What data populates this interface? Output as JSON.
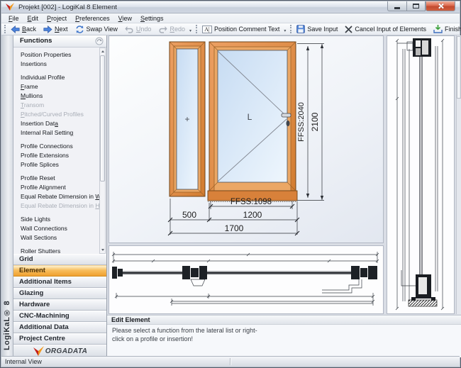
{
  "window": {
    "title": "Projekt [002] - LogiKal 8 Element"
  },
  "menu": {
    "items": [
      {
        "label": "File",
        "accel": 0
      },
      {
        "label": "Edit",
        "accel": 0
      },
      {
        "label": "Project",
        "accel": 0
      },
      {
        "label": "Preferences",
        "accel": 0
      },
      {
        "label": "View",
        "accel": 0
      },
      {
        "label": "Settings",
        "accel": 0
      }
    ]
  },
  "toolbar": {
    "groups": [
      {
        "buttons": [
          {
            "label": "Back",
            "icon": "back-arrow",
            "accel": 0
          },
          {
            "label": "Next",
            "icon": "next-arrow",
            "accel": 0
          },
          {
            "label": "Swap View",
            "icon": "swap-view"
          },
          {
            "label": "Undo",
            "icon": "undo",
            "accel": 0,
            "disabled": true
          },
          {
            "label": "Redo",
            "icon": "redo",
            "accel": 0,
            "disabled": true
          }
        ]
      },
      {
        "buttons": [
          {
            "label": "Position Comment Text",
            "icon": "comment-text"
          }
        ]
      },
      {
        "buttons": [
          {
            "label": "Save Input",
            "icon": "save"
          },
          {
            "label": "Cancel Input of Elements",
            "icon": "cancel"
          },
          {
            "label": "Finish Position",
            "icon": "finish"
          }
        ]
      }
    ]
  },
  "sidebar": {
    "header": "Functions",
    "vertical_label": "LogiKaL® 8",
    "functions": [
      {
        "label": "Position Properties"
      },
      {
        "label": "Insertions"
      },
      {
        "label": "Individual Profile",
        "gap": true
      },
      {
        "label": "Frame",
        "accel": 0
      },
      {
        "label": "Mullions",
        "accel": 0
      },
      {
        "label": "Transom",
        "accel": 0,
        "disabled": true
      },
      {
        "label": "Pitched/Curved Profiles",
        "accel": 0,
        "disabled": true
      },
      {
        "label": "Insertion Data",
        "accel": 13
      },
      {
        "label": "Internal Rail Setting",
        "accel": 20
      },
      {
        "label": "Profile Connections",
        "gap": true
      },
      {
        "label": "Profile Extensions"
      },
      {
        "label": "Profile Splices"
      },
      {
        "label": "Profile Reset",
        "gap": true
      },
      {
        "label": "Profile Alignment"
      },
      {
        "label": "Equal Rebate Dimension in Width",
        "accel": 26
      },
      {
        "label": "Equal Rebate Dimension in Height",
        "accel": 26,
        "disabled": true
      },
      {
        "label": "Side Lights",
        "gap": true
      },
      {
        "label": "Wall Connections"
      },
      {
        "label": "Wall Sections"
      },
      {
        "label": "Roller Shutters",
        "gap": true
      }
    ],
    "accordion": [
      {
        "label": "Grid"
      },
      {
        "label": "Element",
        "active": true
      },
      {
        "label": "Additional Items"
      },
      {
        "label": "Glazing"
      },
      {
        "label": "Hardware"
      },
      {
        "label": "CNC-Machining"
      },
      {
        "label": "Additional Data"
      },
      {
        "label": "Project Centre"
      }
    ],
    "brand": "ORGADATA"
  },
  "drawing": {
    "elevation": {
      "fixed_panel_label": "+",
      "sash_label": "L",
      "dims": {
        "ffss_height": "FFSS:2040",
        "total_height": "2100",
        "ffss_width": "FFSS:1098",
        "width_left": "500",
        "width_sash": "1200",
        "width_total": "1700"
      }
    }
  },
  "edit_panel": {
    "title": "Edit Element",
    "message": "Please select a function from the lateral list or right-click on a profile or insertion!"
  },
  "status_bar": {
    "text": "Internal View"
  },
  "colors": {
    "selection_orange": "#F0A23C",
    "frame_wood": "#DE8C4A",
    "glass_blue": "#D6E6F8",
    "titlebar_silver": "#CDD5E0",
    "close_button_red": "#C9563C"
  }
}
